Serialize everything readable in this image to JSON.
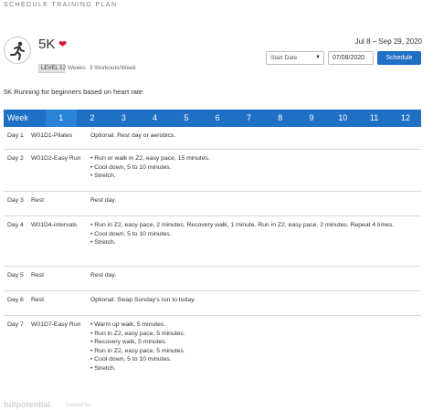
{
  "window": {
    "title": "SCHEDULE TRAINING PLAN"
  },
  "plan": {
    "name": "5K",
    "icon": "runner-icon",
    "favorite_icon": "heart-icon",
    "level": "LEVEL 1",
    "weeks": "12 Weeks",
    "workouts": "3 Workouts/Week",
    "description": "5K Running for beginners based on heart rate"
  },
  "schedule": {
    "date_range": "Jul 8 – Sep 29, 2020",
    "start_select": "Start Date",
    "date_value": "07/08/2020",
    "button": "Schedule"
  },
  "weeks": {
    "label": "Week",
    "numbers": [
      "1",
      "2",
      "3",
      "4",
      "5",
      "6",
      "7",
      "8",
      "9",
      "10",
      "11",
      "12"
    ],
    "selected": "1"
  },
  "days": [
    {
      "day": "Day 1",
      "workout": "W01D1-Pilates",
      "details": [
        "Optional: Rest day or aerobics."
      ]
    },
    {
      "day": "Day 2",
      "workout": "W01D2-Easy Run",
      "details": [
        "• Run or walk in Z2, easy pace, 15 minutes.",
        "• Cool down, 5 to 10 minutes.",
        "• Stretch."
      ]
    },
    {
      "day": "Day 3",
      "workout": "Rest",
      "details": [
        "Rest day."
      ]
    },
    {
      "day": "Day 4",
      "workout": "W01D4-intervals",
      "details": [
        "• Run in Z2, easy pace, 2 minutes. Recovery walk, 1 minute. Run in Z2, easy pace, 2 minutes. Repeat 4 times.",
        "• Cool down, 5 to 10 minutes.",
        "• Stretch."
      ]
    },
    {
      "day": "Day 5",
      "workout": "Rest",
      "details": [
        "Rest day."
      ]
    },
    {
      "day": "Day 6",
      "workout": "Rest",
      "details": [
        "Optional: Swap Sunday's run to today."
      ]
    },
    {
      "day": "Day 7",
      "workout": "W01D7-Easy Run",
      "details": [
        "• Warm up walk, 5 minutes.",
        "• Run in Z2, easy pace, 5 minutes.",
        "• Recovery walk, 5 minutes.",
        "• Run in Z2, easy pace, 5 minutes.",
        "• Cool down, 5 to 10 minutes.",
        "• Stretch."
      ]
    }
  ],
  "footer": {
    "logo": "fullpotential",
    "created": "Created by"
  },
  "colors": {
    "accent": "#1f6fc5",
    "week_active": "#2b82d9",
    "heart": "#d0112b"
  }
}
